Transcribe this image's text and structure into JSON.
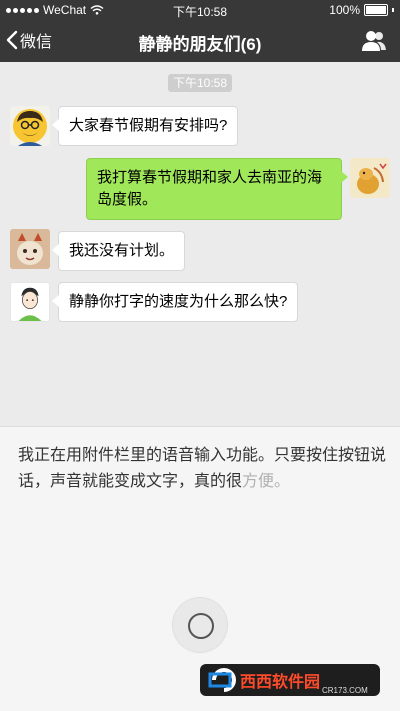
{
  "status_bar": {
    "carrier": "WeChat",
    "time": "下午10:58",
    "battery": "100%"
  },
  "nav": {
    "back_label": "微信",
    "title": "静静的朋友们(6)",
    "right_icon": "group-icon"
  },
  "chat": {
    "timestamp": "下午10:58",
    "messages": [
      {
        "side": "left",
        "text": "大家春节假期有安排吗?"
      },
      {
        "side": "right",
        "text": "我打算春节假期和家人去南亚的海岛度假。"
      },
      {
        "side": "left",
        "text": "我还没有计划。"
      },
      {
        "side": "left",
        "text": "静静你打字的速度为什么那么快?"
      }
    ]
  },
  "voice_input": {
    "text": "我正在用附件栏里的语音输入功能。只要按住按钮说话，声音就能变成文字，真的很",
    "text_pending": "方便。"
  },
  "watermark": {
    "brand": "西西软件园",
    "url": "CR173.COM"
  }
}
